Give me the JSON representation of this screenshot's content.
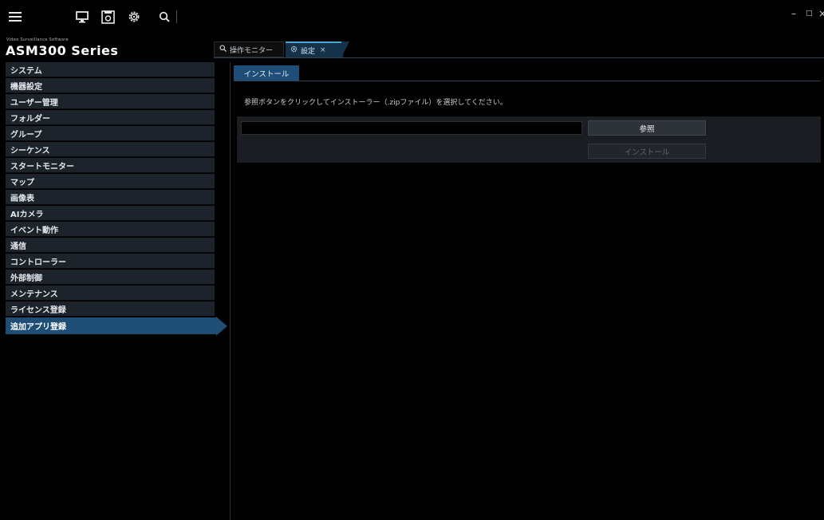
{
  "app": {
    "subtitle": "Video Surveillance Software",
    "title": "ASM300 Series"
  },
  "toolbar": {
    "icons": [
      "menu-icon",
      "monitor-icon",
      "settings-doc-icon",
      "gear-icon",
      "search-icon"
    ]
  },
  "window_controls": {
    "minimize": "–",
    "maximize": "□",
    "close": "×"
  },
  "tabs": [
    {
      "label": "操作モニター",
      "icon": "search-icon",
      "active": false
    },
    {
      "label": "設定",
      "icon": "gear-icon",
      "active": true,
      "close": "×"
    }
  ],
  "sidebar": {
    "items": [
      {
        "label": "システム"
      },
      {
        "label": "機器設定"
      },
      {
        "label": "ユーザー管理"
      },
      {
        "label": "フォルダー"
      },
      {
        "label": "グループ"
      },
      {
        "label": "シーケンス"
      },
      {
        "label": "スタートモニター"
      },
      {
        "label": "マップ"
      },
      {
        "label": "画像表"
      },
      {
        "label": "AIカメラ"
      },
      {
        "label": "イベント動作"
      },
      {
        "label": "通信"
      },
      {
        "label": "コントローラー"
      },
      {
        "label": "外部制御"
      },
      {
        "label": "メンテナンス"
      },
      {
        "label": "ライセンス登録"
      },
      {
        "label": "追加アプリ登録",
        "active": true
      }
    ]
  },
  "main": {
    "tab_label": "インストール",
    "instruction": "参照ボタンをクリックしてインストーラー（.zipファイル）を選択してください。",
    "file_input_value": "",
    "browse_button": "参照",
    "install_button": "インストール"
  },
  "colors": {
    "accent": "#1e4e75",
    "tab_active_border": "#4ca3d6",
    "sidebar_item_bg": "#1d232a",
    "background": "#000000"
  }
}
